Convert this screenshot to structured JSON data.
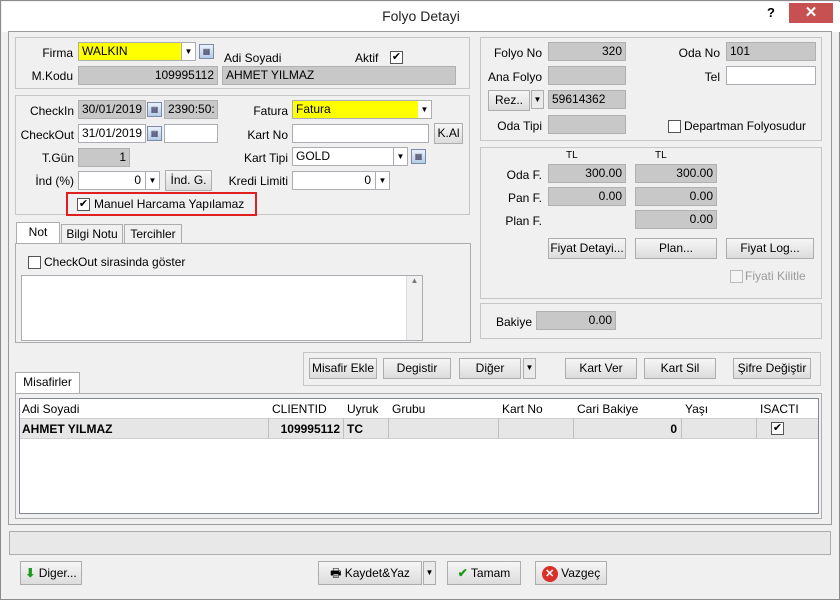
{
  "window": {
    "title": "Folyo Detayi",
    "help": "?",
    "close": "✕"
  },
  "guest": {
    "firma_label": "Firma",
    "firma_value": "WALKIN",
    "mkodu_label": "M.Kodu",
    "mkodu_value": "109995112",
    "adi_label": "Adi Soyadi",
    "aktif_label": "Aktif",
    "aktif_checked": "✔",
    "adi_value": "AHMET YILMAZ"
  },
  "stay": {
    "checkin_label": "CheckIn",
    "checkin_date": "30/01/2019",
    "checkin_time": "2390:50:",
    "checkout_label": "CheckOut",
    "checkout_date": "31/01/2019",
    "tgun_label": "T.Gün",
    "tgun_value": "1",
    "ind_label": "İnd (%)",
    "ind_value": "0",
    "ind_button": "İnd. G.",
    "fatura_label": "Fatura",
    "fatura_value": "Fatura",
    "kartno_label": "Kart No",
    "kartno_value": "",
    "kal_button": "K.Al",
    "karttipi_label": "Kart Tipi",
    "karttipi_value": "GOLD",
    "kredi_label": "Kredi Limiti",
    "kredi_value": "0",
    "manuel_label": "Manuel Harcama Yapılamaz",
    "manuel_checked": "✔"
  },
  "tabs": {
    "t1": "Not",
    "t2": "Bilgi Notu",
    "t3": "Tercihler",
    "checkout_show": "CheckOut sirasinda göster"
  },
  "folio": {
    "folyono_label": "Folyo No",
    "folyono_value": "320",
    "odano_label": "Oda No",
    "odano_value": "101",
    "anafolyo_label": "Ana Folyo",
    "anafolyo_value": "",
    "tel_label": "Tel",
    "tel_value": "",
    "rez_button": "Rez..",
    "rez_value": "59614362",
    "odatipi_label": "Oda Tipi",
    "odatipi_value": "",
    "departman_label": "Departman Folyosudur"
  },
  "prices": {
    "tl1": "TL",
    "tl2": "TL",
    "odaf_label": "Oda F.",
    "odaf_v1": "300.00",
    "odaf_v2": "300.00",
    "panf_label": "Pan F.",
    "panf_v1": "0.00",
    "panf_v2": "0.00",
    "planf_label": "Plan F.",
    "planf_v2": "0.00",
    "fiyat_detay": "Fiyat Detayi...",
    "plan": "Plan...",
    "fiyat_log": "Fiyat Log...",
    "kilitle": "Fiyati Kilitle",
    "bakiye_label": "Bakiye",
    "bakiye_value": "0.00"
  },
  "actions": {
    "misafir_ekle": "Misafir Ekle",
    "degistir": "Degistir",
    "diger": "Diğer",
    "kart_ver": "Kart Ver",
    "kart_sil": "Kart Sil",
    "sifre": "Şifre Değiştir"
  },
  "guests": {
    "tab": "Misafirler",
    "columns": [
      "Adi Soyadi",
      "CLIENTID",
      "Uyruk",
      "Grubu",
      "Kart No",
      "Cari Bakiye",
      "Yaşı",
      "ISACTI"
    ],
    "row": {
      "adi": "AHMET YILMAZ",
      "clientid": "109995112",
      "uyruk": "TC",
      "grubu": "",
      "kartno": "",
      "cari": "0",
      "yasi": "",
      "isactive": "✔"
    }
  },
  "footer": {
    "diger": "Diger...",
    "kaydet": "Kaydet&Yaz",
    "tamam": "Tamam",
    "vazgec": "Vazgeç"
  }
}
